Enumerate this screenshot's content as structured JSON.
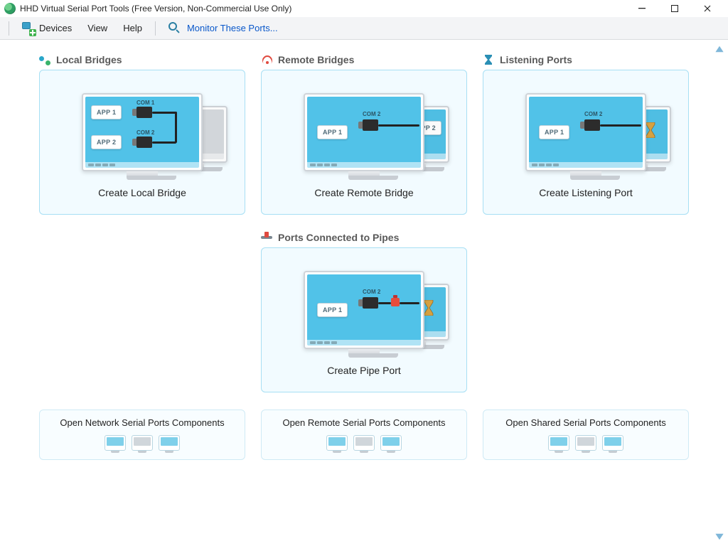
{
  "window": {
    "title": "HHD Virtual Serial Port Tools (Free Version, Non-Commercial Use Only)"
  },
  "menu": {
    "devices": "Devices",
    "view": "View",
    "help": "Help",
    "monitor_link": "Monitor These Ports..."
  },
  "sections": {
    "local_bridges": {
      "title": "Local Bridges",
      "action": "Create Local Bridge",
      "app1": "APP 1",
      "app2": "APP 2",
      "port1": "COM 1",
      "port2": "COM 2"
    },
    "remote_bridges": {
      "title": "Remote Bridges",
      "action": "Create Remote Bridge",
      "app1": "APP 1",
      "app2": "APP 2",
      "port": "COM 2"
    },
    "listening_ports": {
      "title": "Listening Ports",
      "action": "Create Listening Port",
      "app1": "APP 1",
      "port": "COM 2"
    },
    "pipes": {
      "title": "Ports Connected to Pipes",
      "action": "Create Pipe Port",
      "app1": "APP 1",
      "port": "COM 2"
    }
  },
  "links": {
    "network": "Open Network Serial Ports Components",
    "remote": "Open Remote Serial Ports Components",
    "shared": "Open Shared Serial Ports Components"
  }
}
